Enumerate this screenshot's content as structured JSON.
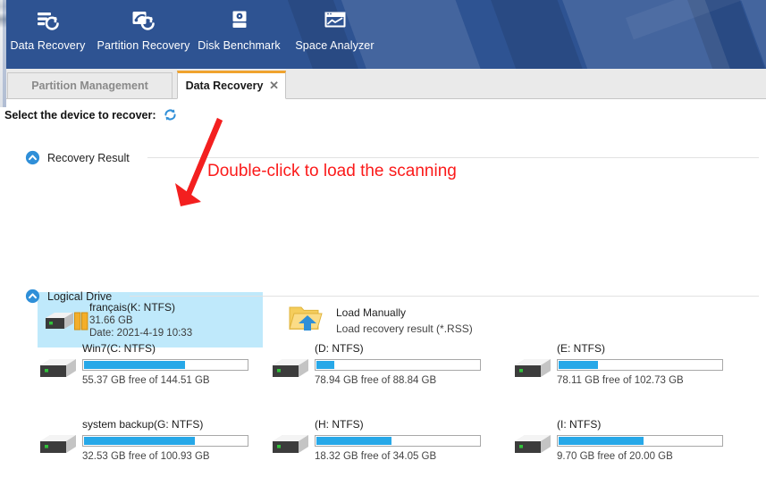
{
  "ribbon": {
    "background_color": "#2e5392",
    "tools": [
      {
        "label": "Data Recovery",
        "icon": "data-recovery-icon"
      },
      {
        "label": "Partition Recovery",
        "icon": "partition-recovery-icon"
      },
      {
        "label": "Disk Benchmark",
        "icon": "disk-benchmark-icon"
      },
      {
        "label": "Space Analyzer",
        "icon": "space-analyzer-icon"
      }
    ]
  },
  "tabs": {
    "inactive_label": "Partition Management",
    "active_label": "Data Recovery",
    "close_glyph": "✕",
    "active_accent_color": "#f0a32e"
  },
  "toolbar": {
    "select_label": "Select the device to recover:",
    "refresh_icon": "refresh-icon"
  },
  "sections": {
    "recovery_result": {
      "title": "Recovery Result",
      "toggle_icon": "chevron-up-circle-icon"
    },
    "logical_drive": {
      "title": "Logical Drive",
      "toggle_icon": "chevron-up-circle-icon"
    }
  },
  "recovery_result": {
    "selected_item": {
      "name": "français(K: NTFS)",
      "size": "31.66 GB",
      "date": "Date: 2021-4-19 10:33",
      "icon": "drive-partition-icon",
      "highlight_color": "#bfe9fb",
      "selected": true
    },
    "load_manually": {
      "title": "Load Manually",
      "subtitle": "Load recovery result (*.RSS)",
      "icon": "folder-open-arrow-icon"
    }
  },
  "logical_drives": [
    {
      "name": "Win7(C: NTFS)",
      "free_text": "55.37 GB free of 144.51 GB",
      "free_gb": 55.37,
      "total_gb": 144.51,
      "used_percent": 62,
      "icon": "hard-drive-icon"
    },
    {
      "name": "(D: NTFS)",
      "free_text": "78.94 GB free of 88.84 GB",
      "free_gb": 78.94,
      "total_gb": 88.84,
      "used_percent": 11,
      "icon": "hard-drive-icon"
    },
    {
      "name": "(E: NTFS)",
      "free_text": "78.11 GB free of 102.73 GB",
      "free_gb": 78.11,
      "total_gb": 102.73,
      "used_percent": 24,
      "icon": "hard-drive-icon"
    },
    {
      "name": "system backup(G: NTFS)",
      "free_text": "32.53 GB free of 100.93 GB",
      "free_gb": 32.53,
      "total_gb": 100.93,
      "used_percent": 68,
      "icon": "hard-drive-icon"
    },
    {
      "name": "(H: NTFS)",
      "free_text": "18.32 GB free of 34.05 GB",
      "free_gb": 18.32,
      "total_gb": 34.05,
      "used_percent": 46,
      "icon": "hard-drive-icon"
    },
    {
      "name": "(I: NTFS)",
      "free_text": "9.70 GB free of 20.00 GB",
      "free_gb": 9.7,
      "total_gb": 20.0,
      "used_percent": 52,
      "icon": "hard-drive-icon"
    }
  ],
  "annotation": {
    "text": "Double-click to load the scanning",
    "color": "#fb1a1a",
    "arrow_icon": "red-arrow-icon"
  },
  "colors": {
    "progress_fill": "#27a8e8",
    "accent_blue": "#1a8fd1",
    "ribbon_blue": "#2e5392"
  }
}
